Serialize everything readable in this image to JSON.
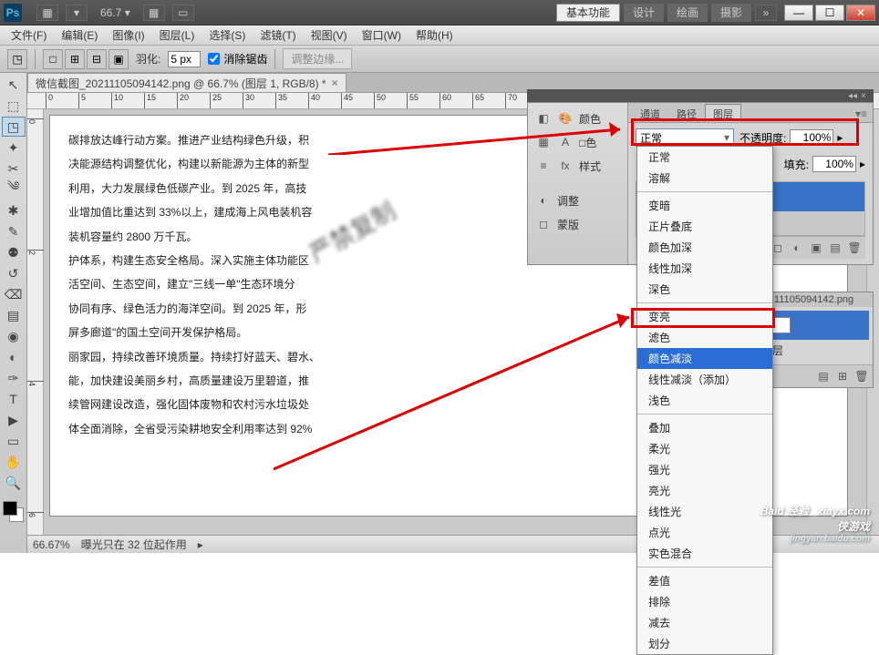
{
  "titlebar": {
    "ps": "Ps",
    "zoom": "66.7",
    "workspaces": [
      "基本功能",
      "设计",
      "绘画",
      "摄影"
    ]
  },
  "menu": [
    "文件(F)",
    "编辑(E)",
    "图像(I)",
    "图层(L)",
    "选择(S)",
    "滤镜(T)",
    "视图(V)",
    "窗口(W)",
    "帮助(H)"
  ],
  "options": {
    "feather_label": "羽化:",
    "feather_value": "5 px",
    "antialias": "消除锯齿",
    "refine": "调整边缘..."
  },
  "doctab": "微信截图_20211105094142.png @ 66.7% (图层 1, RGB/8) *",
  "ruler_h": [
    "0",
    "5",
    "10",
    "15",
    "20",
    "25",
    "30",
    "35",
    "40",
    "45",
    "50",
    "55",
    "60",
    "65",
    "70"
  ],
  "ruler_v": [
    "0",
    "2",
    "4",
    "6"
  ],
  "document_text": "碳排放达峰行动方案。推进产业结构绿色升级，积\n决能源结构调整优化，构建以新能源为主体的新型\n利用，大力发展绿色低碳产业。到 2025 年，高技\n业增加值比重达到 33%以上，建成海上风电装机容\n装机容量约 2800 万千瓦。\n护体系，构建生态安全格局。深入实施主体功能区\n活空间、生态空间，建立\"三线一单\"生态环境分\n协同有序、绿色活力的海洋空间。到 2025 年，形\n屏多廊道\"的国土空间开发保护格局。\n丽家园，持续改善环境质量。持续打好蓝天、碧水、\n能，加快建设美丽乡村，高质量建设万里碧道，推\n续管网建设改造，强化固体废物和农村污水垃圾处\n体全面消除，全省受污染耕地安全利用率达到 92%",
  "watermark": "严禁复制",
  "statusbar": {
    "zoom": "66.67%",
    "info": "曝光只在 32 位起作用"
  },
  "left_panel": {
    "items": [
      "颜色",
      "□色",
      "样式",
      "调整",
      "蒙版"
    ]
  },
  "layers": {
    "tabs": [
      "通道",
      "路径",
      "图层"
    ],
    "blend_current": "正常",
    "opacity_label": "不透明度:",
    "opacity_value": "100%",
    "fill_label": "填充:",
    "fill_value": "100%"
  },
  "blend_modes": {
    "g0": [
      "正常",
      "溶解"
    ],
    "g1": [
      "变暗",
      "正片叠底",
      "颜色加深",
      "线性加深",
      "深色"
    ],
    "g2": [
      "变亮",
      "滤色",
      "颜色减淡",
      "线性减淡（添加）",
      "浅色"
    ],
    "g3": [
      "叠加",
      "柔光",
      "强光",
      "亮光",
      "线性光",
      "点光",
      "实色混合"
    ],
    "g4": [
      "差值",
      "排除",
      "减去",
      "划分"
    ]
  },
  "mini": {
    "filename": "11105094142.png",
    "layer_label": "层"
  },
  "branding": {
    "site": "xiayx.com",
    "name": "侠游戏",
    "baidu": "Baid",
    "exp": "经验",
    "url": "jingyan.baidu.com"
  }
}
